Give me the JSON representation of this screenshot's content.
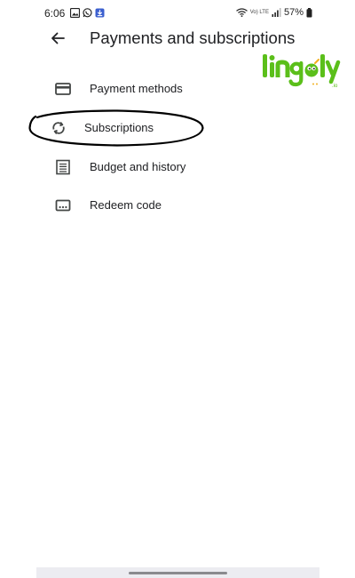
{
  "status_bar": {
    "time": "6:06",
    "battery_percent": "57%",
    "network_label": "Vo) LTE",
    "icons_left": [
      "gallery-icon",
      "whatsapp-icon",
      "download-icon"
    ],
    "icons_right": [
      "wifi-icon",
      "volte-icon",
      "signal-icon",
      "battery-icon"
    ]
  },
  "app_bar": {
    "back_icon": "arrow-back-icon",
    "title": "Payments and subscriptions"
  },
  "logo": {
    "text": "lingoly",
    "suffix": ".io",
    "color": "#5bbf1a"
  },
  "menu": {
    "items": [
      {
        "label": "Payment methods",
        "icon": "credit-card-icon"
      },
      {
        "label": "Subscriptions",
        "icon": "sync-icon"
      },
      {
        "label": "Budget and history",
        "icon": "receipt-list-icon"
      },
      {
        "label": "Redeem code",
        "icon": "redeem-code-icon"
      }
    ]
  },
  "annotation": {
    "target": "Subscriptions",
    "shape": "ellipse",
    "color": "#000000"
  },
  "colors": {
    "text": "#202124",
    "icon": "#444746",
    "nav_bar": "#ececf1",
    "gesture_handle": "#8a8a8e"
  }
}
